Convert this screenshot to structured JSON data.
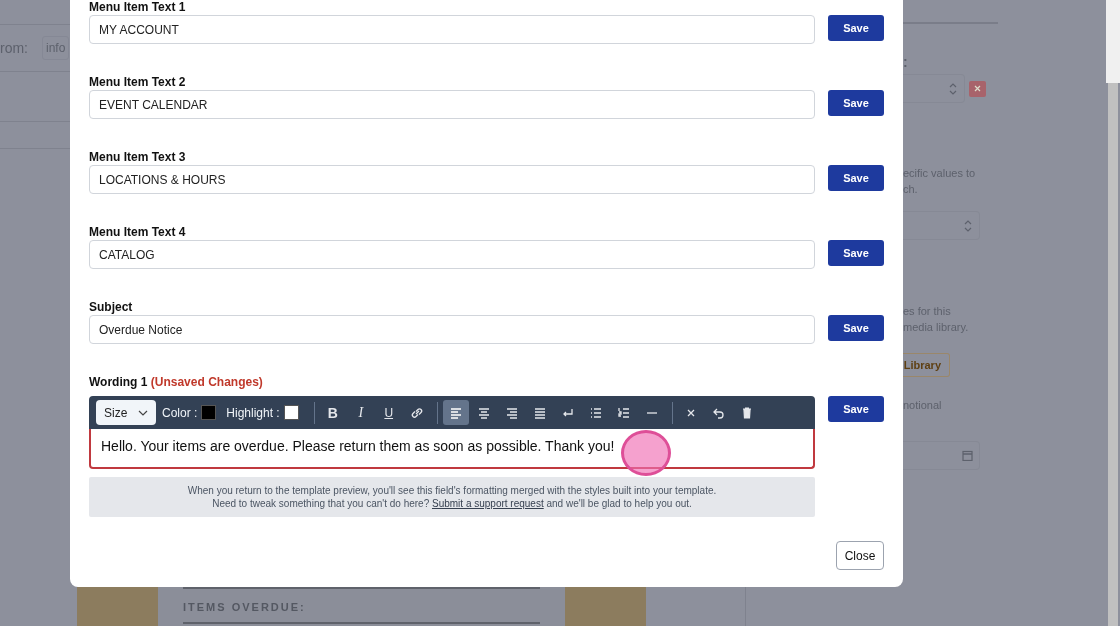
{
  "background": {
    "from_label": "rom:",
    "from_value": "info",
    "preview_heading": "ITEMS OVERDUE:",
    "right_panel": {
      "heading": ":",
      "text_1": "ecific values to",
      "text_2": "ch.",
      "text_3": "es for this",
      "text_4": "media library.",
      "library_button": "Library",
      "text_5": "notional"
    }
  },
  "modal": {
    "fields": [
      {
        "label": "Menu Item Text 1",
        "value": "MY ACCOUNT",
        "button": "Save"
      },
      {
        "label": "Menu Item Text 2",
        "value": "EVENT CALENDAR",
        "button": "Save"
      },
      {
        "label": "Menu Item Text 3",
        "value": "LOCATIONS & HOURS",
        "button": "Save"
      },
      {
        "label": "Menu Item Text 4",
        "value": "CATALOG",
        "button": "Save"
      },
      {
        "label": "Subject",
        "value": "Overdue Notice",
        "button": "Save"
      }
    ],
    "wording": {
      "label": "Wording 1",
      "status": "(Unsaved Changes)",
      "button": "Save",
      "toolbar": {
        "size": "Size",
        "color_label": "Color :",
        "highlight_label": "Highlight :",
        "bold": "B",
        "italic": "I",
        "underline": "U",
        "alignments": [
          {
            "kind": "left",
            "selected": true
          },
          {
            "kind": "center",
            "selected": false
          },
          {
            "kind": "right",
            "selected": false
          },
          {
            "kind": "justify",
            "selected": false
          }
        ]
      },
      "text": "Hello. Your items are overdue. Please return them as soon as possible. Thank you!",
      "note_line_1": "When you return to the template preview, you'll see this field's formatting merged with the styles built into your template.",
      "note_line_2_before": "Need to tweak something that you can't do here?",
      "note_link": "Submit a support request",
      "note_line_2_after": "and we'll be glad to help you out."
    },
    "close_button": "Close"
  }
}
